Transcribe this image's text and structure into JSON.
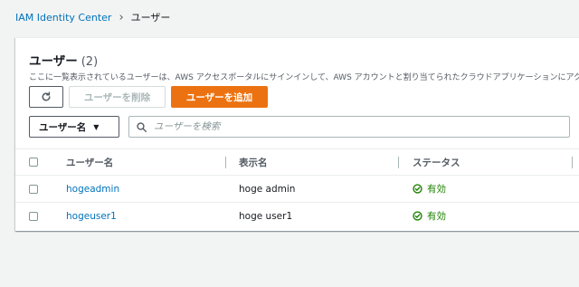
{
  "breadcrumb": {
    "root": "IAM Identity Center",
    "separator": "›",
    "current": "ユーザー"
  },
  "panel": {
    "title": "ユーザー",
    "count": "(2)",
    "description": "ここに一覧表示されているユーザーは、AWS アクセスポータルにサインインして、AWS アカウントと割り当てられたクラウドアプリケーションにアク"
  },
  "toolbar": {
    "refresh_icon": "refresh-icon",
    "delete_label": "ユーザーを削除",
    "add_label": "ユーザーを追加"
  },
  "filter": {
    "property_label": "ユーザー名",
    "search_placeholder": "ユーザーを検索"
  },
  "table": {
    "columns": [
      "ユーザー名",
      "表示名",
      "ステータス"
    ],
    "rows": [
      {
        "username": "hogeadmin",
        "display_name": "hoge admin",
        "status": "有効"
      },
      {
        "username": "hogeuser1",
        "display_name": "hoge user1",
        "status": "有効"
      }
    ]
  },
  "colors": {
    "link": "#0073bb",
    "primary_button": "#ec7211",
    "status_enabled": "#1d8102",
    "background": "#f2f3f3"
  }
}
